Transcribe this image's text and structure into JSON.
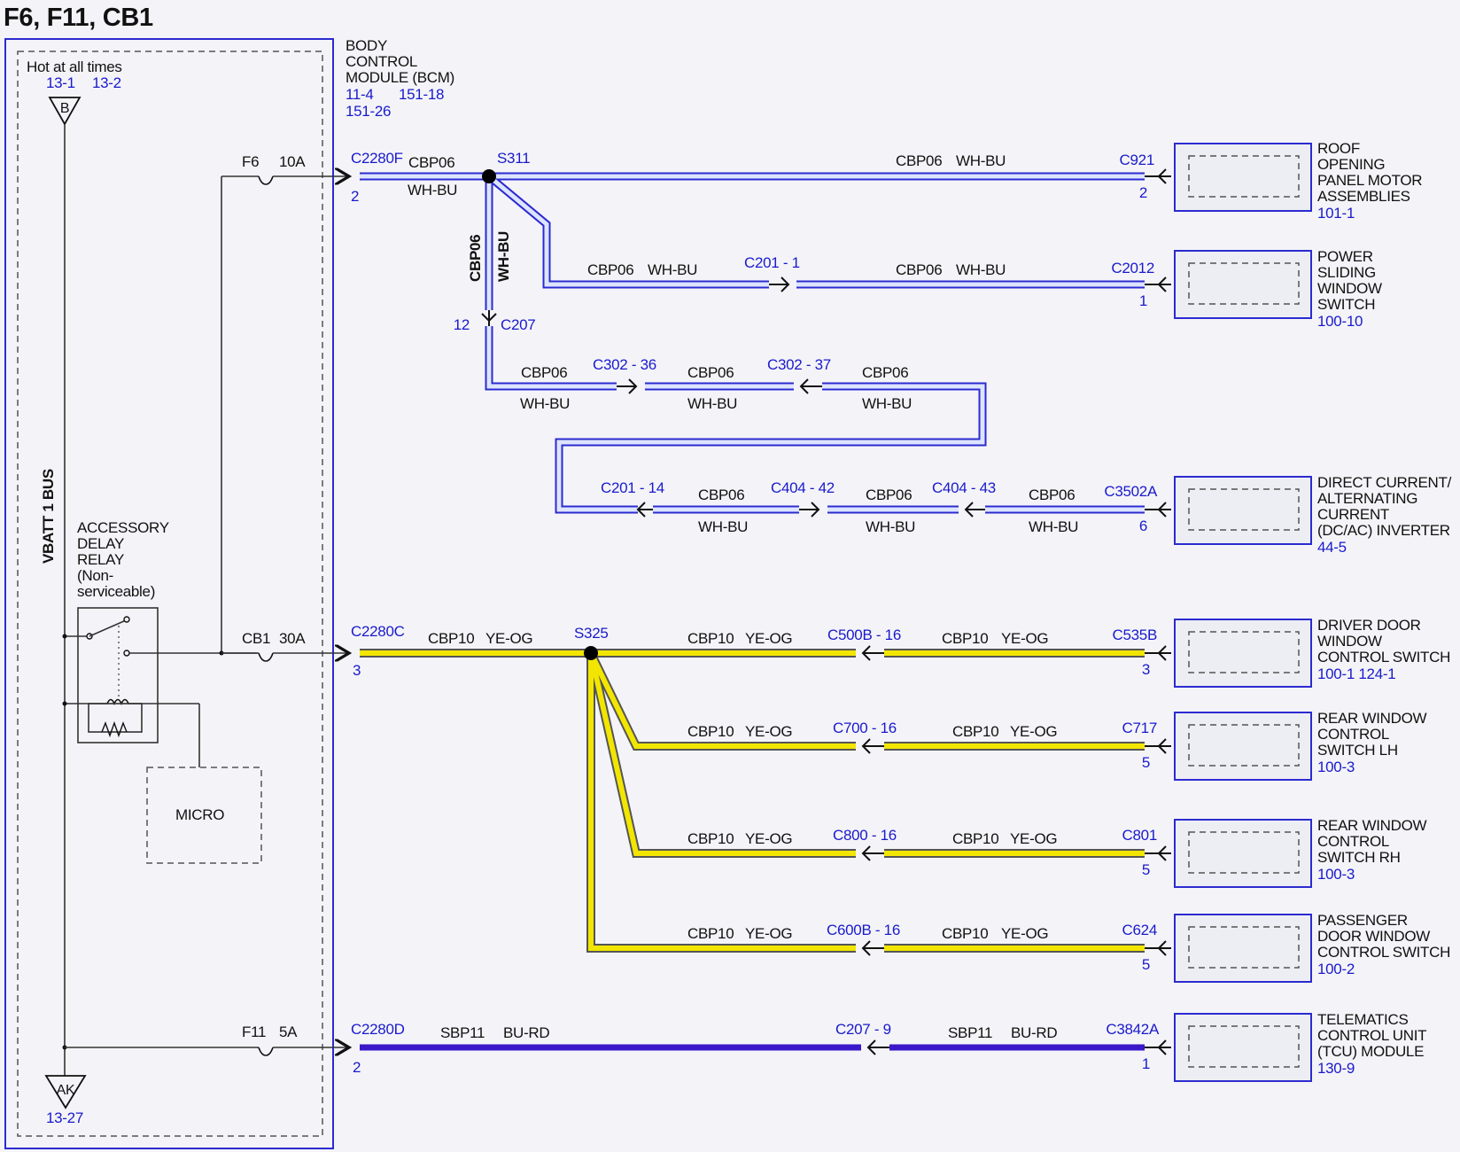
{
  "title": "F6, F11, CB1",
  "bcm": {
    "name_lines": [
      "BODY",
      "CONTROL",
      "MODULE (BCM)"
    ],
    "refs": [
      "11-4",
      "151-18",
      "151-26"
    ]
  },
  "power": {
    "hot_label": "Hot at all times",
    "refs": [
      "13-1",
      "13-2"
    ],
    "b_terminal": "B",
    "bus_label": "VBATT 1 BUS",
    "ground_terminal": "AK",
    "ground_ref": "13-27"
  },
  "relay": {
    "label_lines": [
      "ACCESSORY",
      "DELAY",
      "RELAY",
      "(Non-",
      "serviceable)"
    ],
    "micro_label": "MICRO"
  },
  "fuses": {
    "f6": {
      "name": "F6",
      "rating": "10A"
    },
    "cb1": {
      "name": "CB1",
      "rating": "30A"
    },
    "f11": {
      "name": "F11",
      "rating": "5A"
    }
  },
  "circuits": {
    "cbp06": {
      "circuit": "CBP06",
      "color_code": "WH-BU",
      "color": "#dde4ff"
    },
    "cbp10": {
      "circuit": "CBP10",
      "color_code": "YE-OG",
      "color": "#f2e600"
    },
    "sbp11": {
      "circuit": "SBP11",
      "color_code": "BU-RD",
      "color": "#3a17c8"
    }
  },
  "connectors": {
    "c2280f": {
      "name": "C2280F",
      "pin": "2"
    },
    "c2280c": {
      "name": "C2280C",
      "pin": "3"
    },
    "c2280d": {
      "name": "C2280D",
      "pin": "2"
    },
    "s311": "S311",
    "s325": "S325",
    "c207": {
      "name": "C207",
      "pin": "12"
    },
    "c201_1": "C201 - 1",
    "c302_36": "C302 - 36",
    "c302_37": "C302 - 37",
    "c201_14": "C201 - 14",
    "c404_42": "C404 - 42",
    "c404_43": "C404 - 43",
    "c500b_16": "C500B - 16",
    "c700_16": "C700 - 16",
    "c800_16": "C800 - 16",
    "c600b_16": "C600B - 16",
    "c207_9": "C207 - 9"
  },
  "components": [
    {
      "connector": "C921",
      "pin": "2",
      "name_lines": [
        "ROOF",
        "OPENING",
        "PANEL MOTOR",
        "ASSEMBLIES"
      ],
      "refs": "101-1"
    },
    {
      "connector": "C2012",
      "pin": "1",
      "name_lines": [
        "POWER",
        "SLIDING",
        "WINDOW",
        "SWITCH"
      ],
      "refs": "100-10"
    },
    {
      "connector": "C3502A",
      "pin": "6",
      "name_lines": [
        "DIRECT CURRENT/",
        "ALTERNATING",
        "CURRENT",
        "(DC/AC) INVERTER"
      ],
      "refs": "44-5"
    },
    {
      "connector": "C535B",
      "pin": "3",
      "name_lines": [
        "DRIVER DOOR",
        "WINDOW",
        "CONTROL SWITCH"
      ],
      "refs": "100-1  124-1"
    },
    {
      "connector": "C717",
      "pin": "5",
      "name_lines": [
        "REAR WINDOW",
        "CONTROL",
        "SWITCH LH"
      ],
      "refs": "100-3"
    },
    {
      "connector": "C801",
      "pin": "5",
      "name_lines": [
        "REAR WINDOW",
        "CONTROL",
        "SWITCH RH"
      ],
      "refs": "100-3"
    },
    {
      "connector": "C624",
      "pin": "5",
      "name_lines": [
        "PASSENGER",
        "DOOR WINDOW",
        "CONTROL SWITCH"
      ],
      "refs": "100-2"
    },
    {
      "connector": "C3842A",
      "pin": "1",
      "name_lines": [
        "TELEMATICS",
        "CONTROL UNIT",
        "(TCU) MODULE"
      ],
      "refs": "130-9"
    }
  ]
}
